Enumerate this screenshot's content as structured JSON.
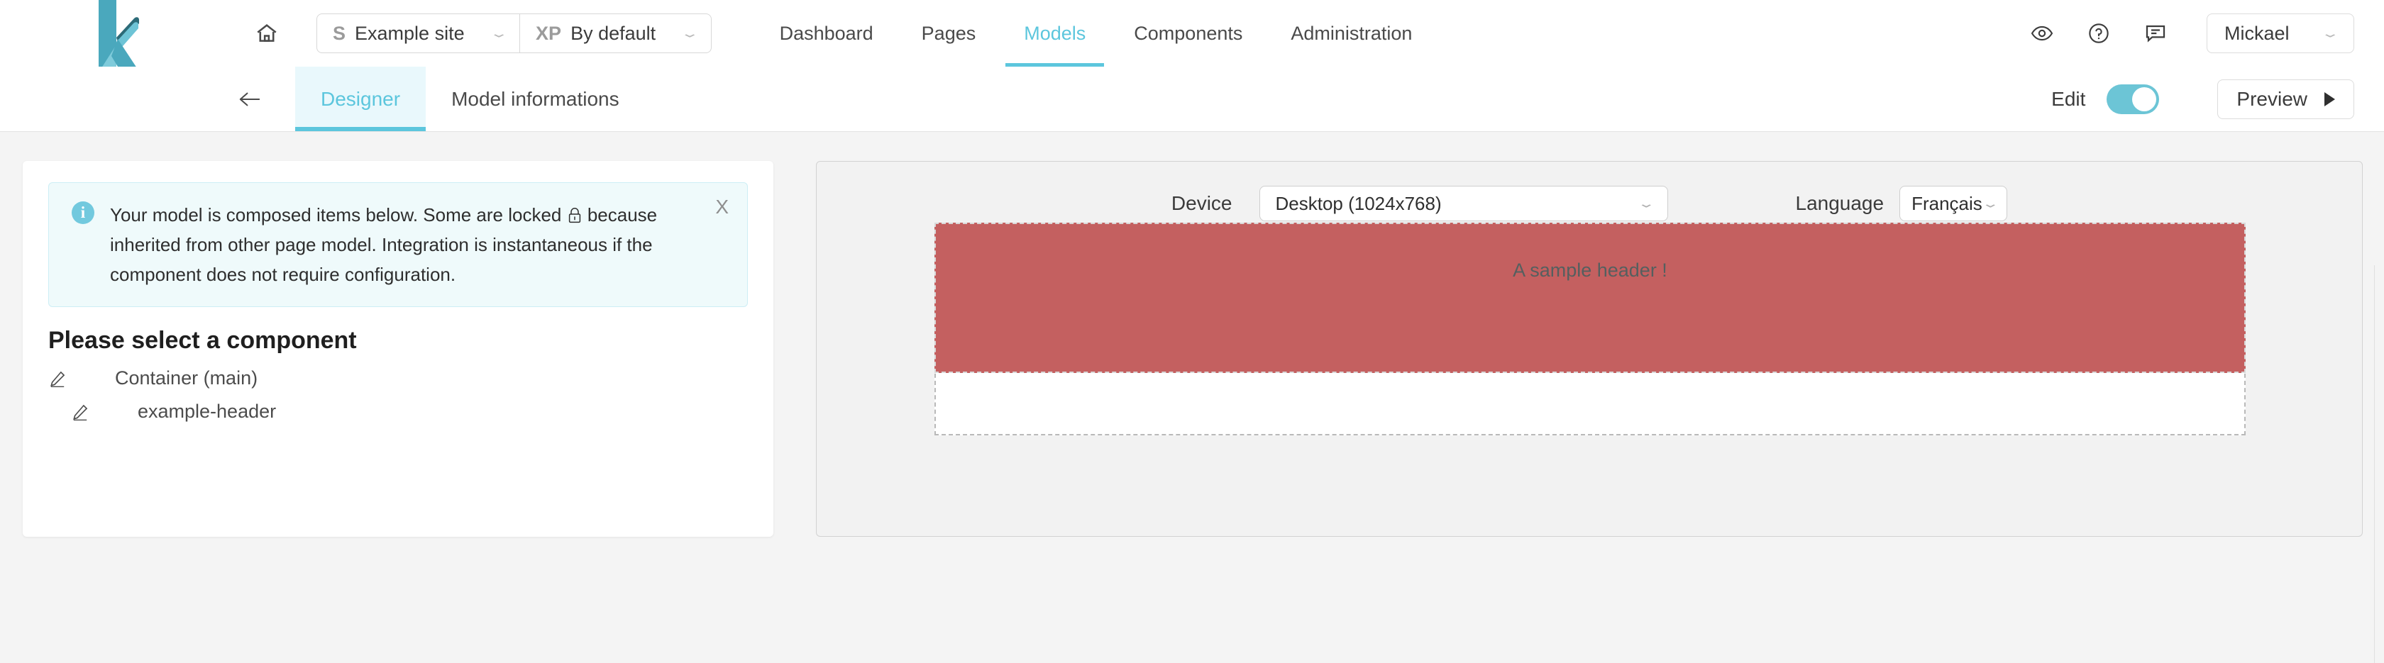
{
  "topbar": {
    "logo_name": "kuzzle-k-logo",
    "home_icon": "home-icon",
    "site_selector": {
      "tag": "S",
      "value": "Example site",
      "caret": "⌄"
    },
    "xp_selector": {
      "tag": "XP",
      "value": "By default",
      "caret": "⌄"
    },
    "nav": [
      {
        "label": "Dashboard",
        "active": false
      },
      {
        "label": "Pages",
        "active": false
      },
      {
        "label": "Models",
        "active": true
      },
      {
        "label": "Components",
        "active": false
      },
      {
        "label": "Administration",
        "active": false
      }
    ],
    "icons": [
      "eye-icon",
      "help-circle-icon",
      "message-icon"
    ],
    "user": {
      "name": "Mickael",
      "caret": "⌄"
    }
  },
  "subbar": {
    "back_icon": "arrow-left-icon",
    "tabs": [
      {
        "label": "Designer",
        "active": true
      },
      {
        "label": "Model informations",
        "active": false
      }
    ],
    "edit_label": "Edit",
    "edit_toggle_on": true,
    "preview_label": "Preview"
  },
  "left_panel": {
    "banner": {
      "icon": "info-icon",
      "text_before_lock": "Your model is composed items below. Some are locked ",
      "lock_glyph": "ὑ2",
      "text_after_lock": " because inherited from other page model. Integration is instantaneous if the component does not require configuration.",
      "full_text": "Your model is composed items below. Some are locked \u0000 because inherited from other page model. Integration is instantaneous if the component does not require configuration.",
      "close_label": "X"
    },
    "title": "Please select a component",
    "tree": [
      {
        "label": "Container (main)",
        "icon": "pencil-icon",
        "indent": false
      },
      {
        "label": "example-header",
        "icon": "pencil-icon",
        "indent": true
      }
    ]
  },
  "right_panel": {
    "device_label": "Device",
    "device_value": "Desktop (1024x768)",
    "device_caret": "⌄",
    "language_label": "Language",
    "language_value": "Français",
    "language_caret": "⌄",
    "stage": {
      "header_text": "A sample header !",
      "header_color": "#c46060"
    }
  },
  "colors": {
    "accent": "#5cc6dd",
    "accent_soft": "#e9f8fc",
    "banner_bg": "#effafb",
    "banner_border": "#cdeef5",
    "toggle_on": "#6cc5d6",
    "stage_header": "#c46060",
    "page_bg": "#f4f4f4"
  }
}
